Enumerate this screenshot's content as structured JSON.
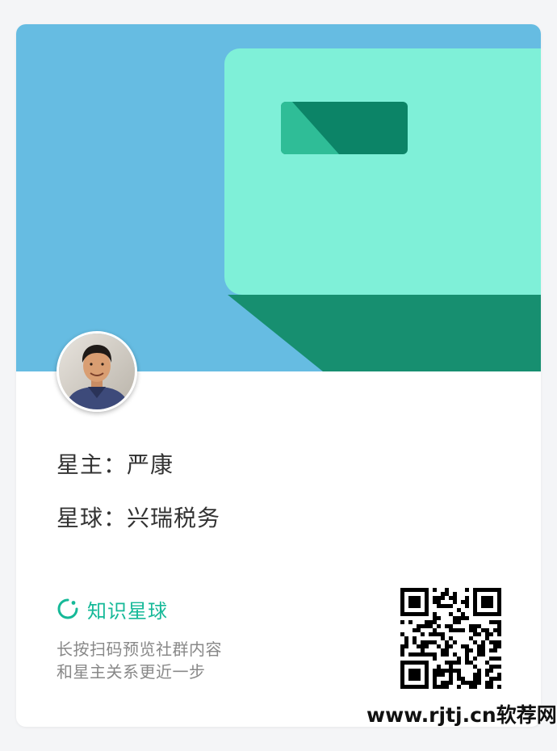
{
  "colors": {
    "banner_sky": "#66bce2",
    "card_face": "#7ff0d8",
    "card_shadow": "#178f70",
    "card_chip_dark": "#0c8467",
    "card_chip_light": "#2fbd97",
    "accent": "#16b998"
  },
  "profile": {
    "owner_line": "星主：严康",
    "planet_line": "星球：兴瑞税务"
  },
  "brand": {
    "icon": "zsxq-logo-icon",
    "name": "知识星球"
  },
  "invite": {
    "line1": "长按扫码预览社群内容",
    "line2": "和星主关系更近一步"
  },
  "qr": {
    "icon": "qr-code"
  },
  "watermark": "www.rjtj.cn软荐网"
}
